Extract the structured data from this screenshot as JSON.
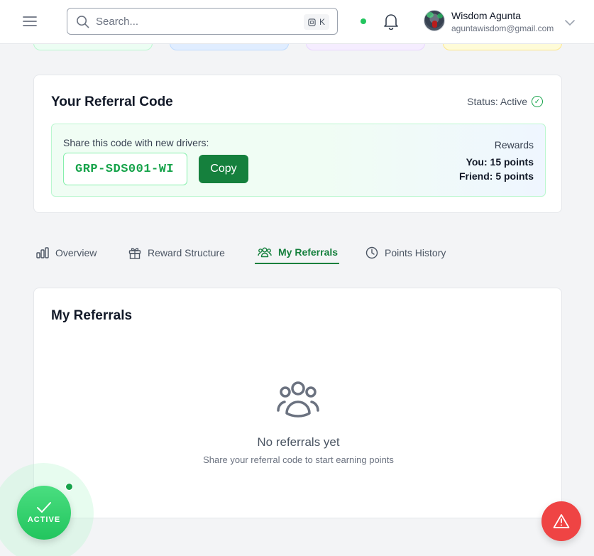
{
  "colors": {
    "accent": "#15803d",
    "online": "#22c55e",
    "alert": "#ef4444",
    "stat_green": "#dcfce7",
    "stat_blue": "#dbeafe",
    "stat_purple": "#f3e8ff",
    "stat_yellow": "#fef9c3"
  },
  "header": {
    "search_placeholder": "Search...",
    "shortcut_key": "K",
    "user_name": "Wisdom Agunta",
    "user_email": "aguntawisdom@gmail.com",
    "icons": [
      "menu-icon",
      "search-icon",
      "command-icon",
      "bell-icon",
      "chevron-down-icon"
    ]
  },
  "referral": {
    "title": "Your Referral Code",
    "status": "Status: Active",
    "share_label": "Share this code with new drivers:",
    "code": "GRP-SDS001-WI",
    "copy_label": "Copy",
    "rewards_title": "Rewards",
    "rewards_you": "You: 15 points",
    "rewards_friend": "Friend: 5 points"
  },
  "tabs": [
    {
      "label": "Overview",
      "icon": "bar-chart-icon",
      "active": false
    },
    {
      "label": "Reward Structure",
      "icon": "gift-icon",
      "active": false
    },
    {
      "label": "My Referrals",
      "icon": "users-icon",
      "active": true
    },
    {
      "label": "Points History",
      "icon": "clock-icon",
      "active": false
    }
  ],
  "referrals_panel": {
    "title": "My Referrals",
    "empty_title": "No referrals yet",
    "empty_subtitle": "Share your referral code to start earning points"
  },
  "floating": {
    "active_label": "ACTIVE"
  }
}
